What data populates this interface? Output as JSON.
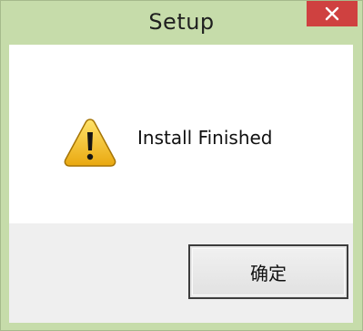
{
  "window": {
    "title": "Setup",
    "close_symbol": "✕",
    "close_icon": "close-icon"
  },
  "dialog": {
    "icon": "warning-icon",
    "message": "Install Finished",
    "ok_label": "确定"
  },
  "colors": {
    "frame": "#c6dcaa",
    "close_button": "#cf4140",
    "footer": "#efefef",
    "warning_yellow": "#f3c21b"
  }
}
